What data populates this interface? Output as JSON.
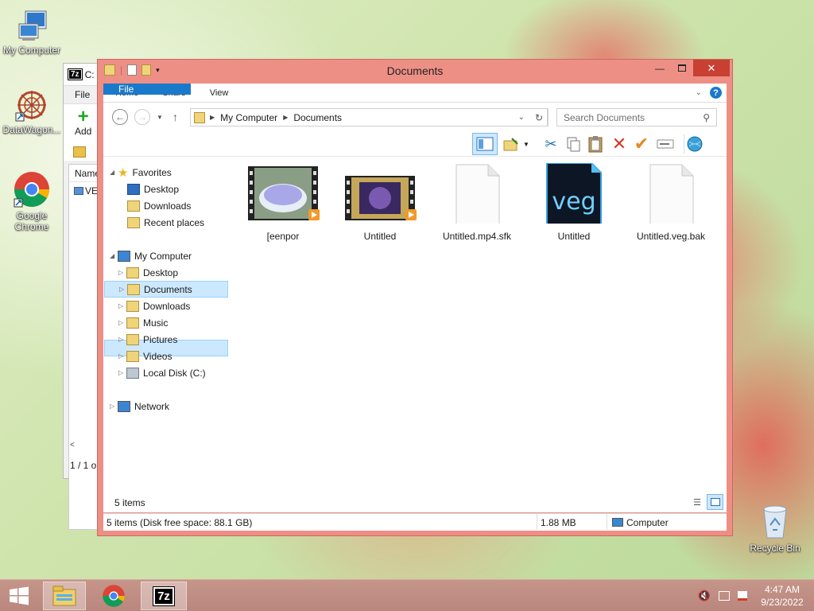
{
  "desktop": {
    "icons": [
      {
        "label": "My Computer",
        "icon": "computer-icon"
      },
      {
        "label": "DataWagon...",
        "icon": "datawagon-icon"
      },
      {
        "label": "Google Chrome",
        "icon": "chrome-icon"
      },
      {
        "label": "Recycle Bin",
        "icon": "recycle-bin-icon"
      }
    ]
  },
  "bg_window": {
    "title": "C:",
    "menu": "File",
    "add_label": "Add",
    "col": "Name",
    "row": "VE",
    "status": "1 / 1 o"
  },
  "explorer": {
    "title": "Documents",
    "tabs": [
      "File",
      "Home",
      "Share",
      "View"
    ],
    "breadcrumb": [
      "My Computer",
      "Documents"
    ],
    "search_placeholder": "Search Documents",
    "nav": {
      "favorites": "Favorites",
      "fav_items": [
        "Desktop",
        "Downloads",
        "Recent places"
      ],
      "computer": "My Computer",
      "computer_items": [
        "Desktop",
        "Documents",
        "Downloads",
        "Music",
        "Pictures",
        "Videos",
        "Local Disk (C:)"
      ],
      "network": "Network"
    },
    "files": [
      {
        "name": "[eenpor",
        "type": "video"
      },
      {
        "name": "Untitled",
        "type": "video"
      },
      {
        "name": "Untitled.mp4.sfk",
        "type": "blank"
      },
      {
        "name": "Untitled",
        "type": "veg"
      },
      {
        "name": "Untitled.veg.bak",
        "type": "blank"
      }
    ],
    "veg_label": "veg",
    "items_count": "5 items",
    "status_left": "5 items (Disk free space: 88.1 GB)",
    "status_size": "1.88 MB",
    "status_location": "Computer"
  },
  "taskbar": {
    "time": "4:47 AM",
    "date": "9/23/2022",
    "seven_zip_label": "7z"
  },
  "colors": {
    "accent": "#1979ca",
    "window_frame": "#ee8f86",
    "close": "#c84031",
    "selection": "#cce8ff"
  }
}
